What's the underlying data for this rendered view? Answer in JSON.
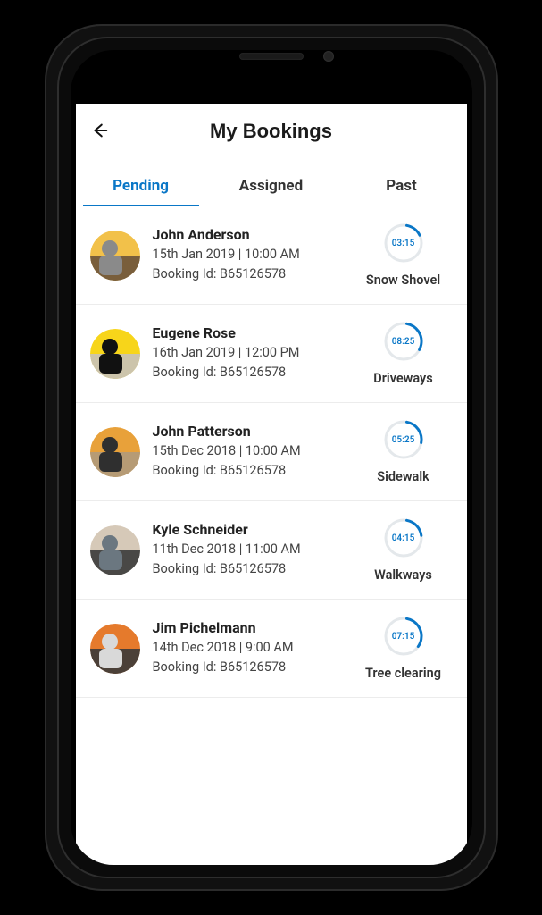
{
  "header": {
    "title": "My Bookings"
  },
  "tabs": [
    {
      "label": "Pending",
      "active": true
    },
    {
      "label": "Assigned",
      "active": false
    },
    {
      "label": "Past",
      "active": false
    }
  ],
  "bookings": [
    {
      "name": "John Anderson",
      "datetime": "15th Jan 2019 | 10:00 AM",
      "booking_id_label": "Booking Id: B65126578",
      "timer": "03:15",
      "category": "Snow Shovel",
      "progress": 0.15,
      "avatar_colors": [
        "#f2c14a",
        "#8a8a8a",
        "#6b533a"
      ]
    },
    {
      "name": "Eugene Rose",
      "datetime": "16th Jan 2019 | 12:00 PM",
      "booking_id_label": "Booking Id: B65126578",
      "timer": "08:25",
      "category": "Driveways",
      "progress": 0.3,
      "avatar_colors": [
        "#f7d51a",
        "#111",
        "#c7c2bb"
      ]
    },
    {
      "name": "John Patterson",
      "datetime": "15th Dec 2018 | 10:00 AM",
      "booking_id_label": "Booking Id: B65126578",
      "timer": "05:25",
      "category": "Sidewalk",
      "progress": 0.25,
      "avatar_colors": [
        "#e8a13a",
        "#2f2f2f",
        "#b09a7c"
      ]
    },
    {
      "name": "Kyle Schneider",
      "datetime": "11th Dec 2018 | 11:00 AM",
      "booking_id_label": "Booking Id: B65126578",
      "timer": "04:15",
      "category": "Walkways",
      "progress": 0.2,
      "avatar_colors": [
        "#d6c9b8",
        "#6b7780",
        "#3a3a3a"
      ]
    },
    {
      "name": "Jim Pichelmann",
      "datetime": "14th Dec 2018 | 9:00 AM",
      "booking_id_label": "Booking Id: B65126578",
      "timer": "07:15",
      "category": "Tree clearing",
      "progress": 0.32,
      "avatar_colors": [
        "#e57a2c",
        "#d9d9d9",
        "#3a3a3a"
      ]
    }
  ],
  "colors": {
    "accent": "#0a77c7",
    "timer_track": "#e4e8eb"
  }
}
